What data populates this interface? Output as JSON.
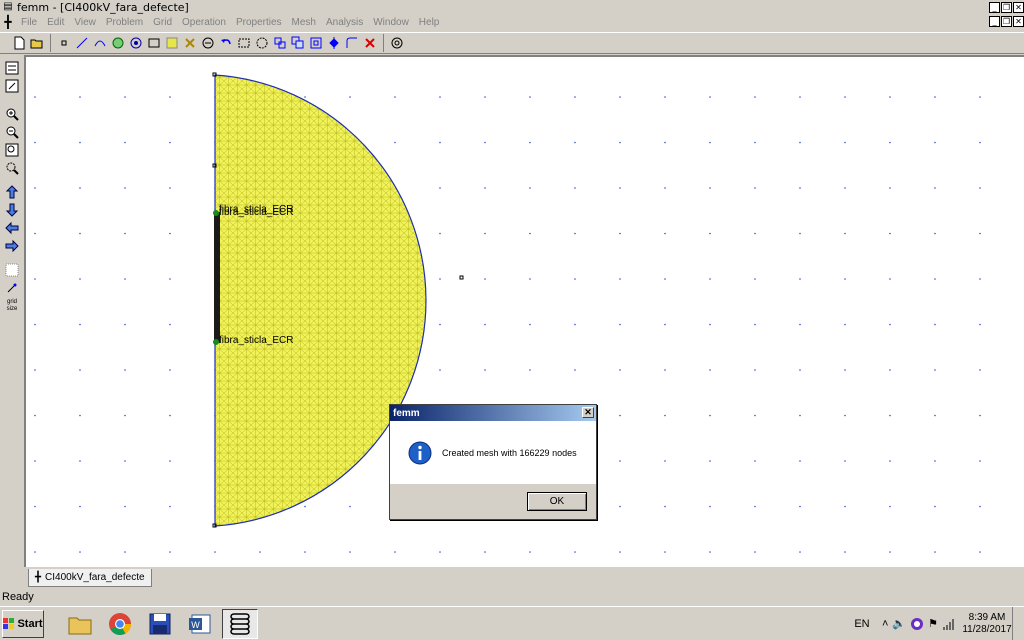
{
  "window": {
    "title": "femm - [CI400kV_fara_defecte]"
  },
  "menu": [
    "File",
    "Edit",
    "View",
    "Problem",
    "Grid",
    "Operation",
    "Properties",
    "Mesh",
    "Analysis",
    "Window",
    "Help"
  ],
  "canvas": {
    "labels": [
      "fibra_sticla_ECR",
      "fibra_sticla_ECR",
      "fibra_sticla_ECR"
    ],
    "mesh_color": "#ecec3a",
    "boundary_color": "#1f2fb0"
  },
  "doc_tab": {
    "label": "CI400kV_fara_defecte"
  },
  "status": {
    "text": "Ready"
  },
  "dialog": {
    "title": "femm",
    "message": "Created mesh with 166229 nodes",
    "ok_label": "OK",
    "close_glyph": "✕"
  },
  "taskbar": {
    "start_label": "Start",
    "lang": "EN",
    "time": "8:39 AM",
    "date": "11/28/2017"
  },
  "left_toolbar": {
    "grid_size_label": "grid size"
  }
}
